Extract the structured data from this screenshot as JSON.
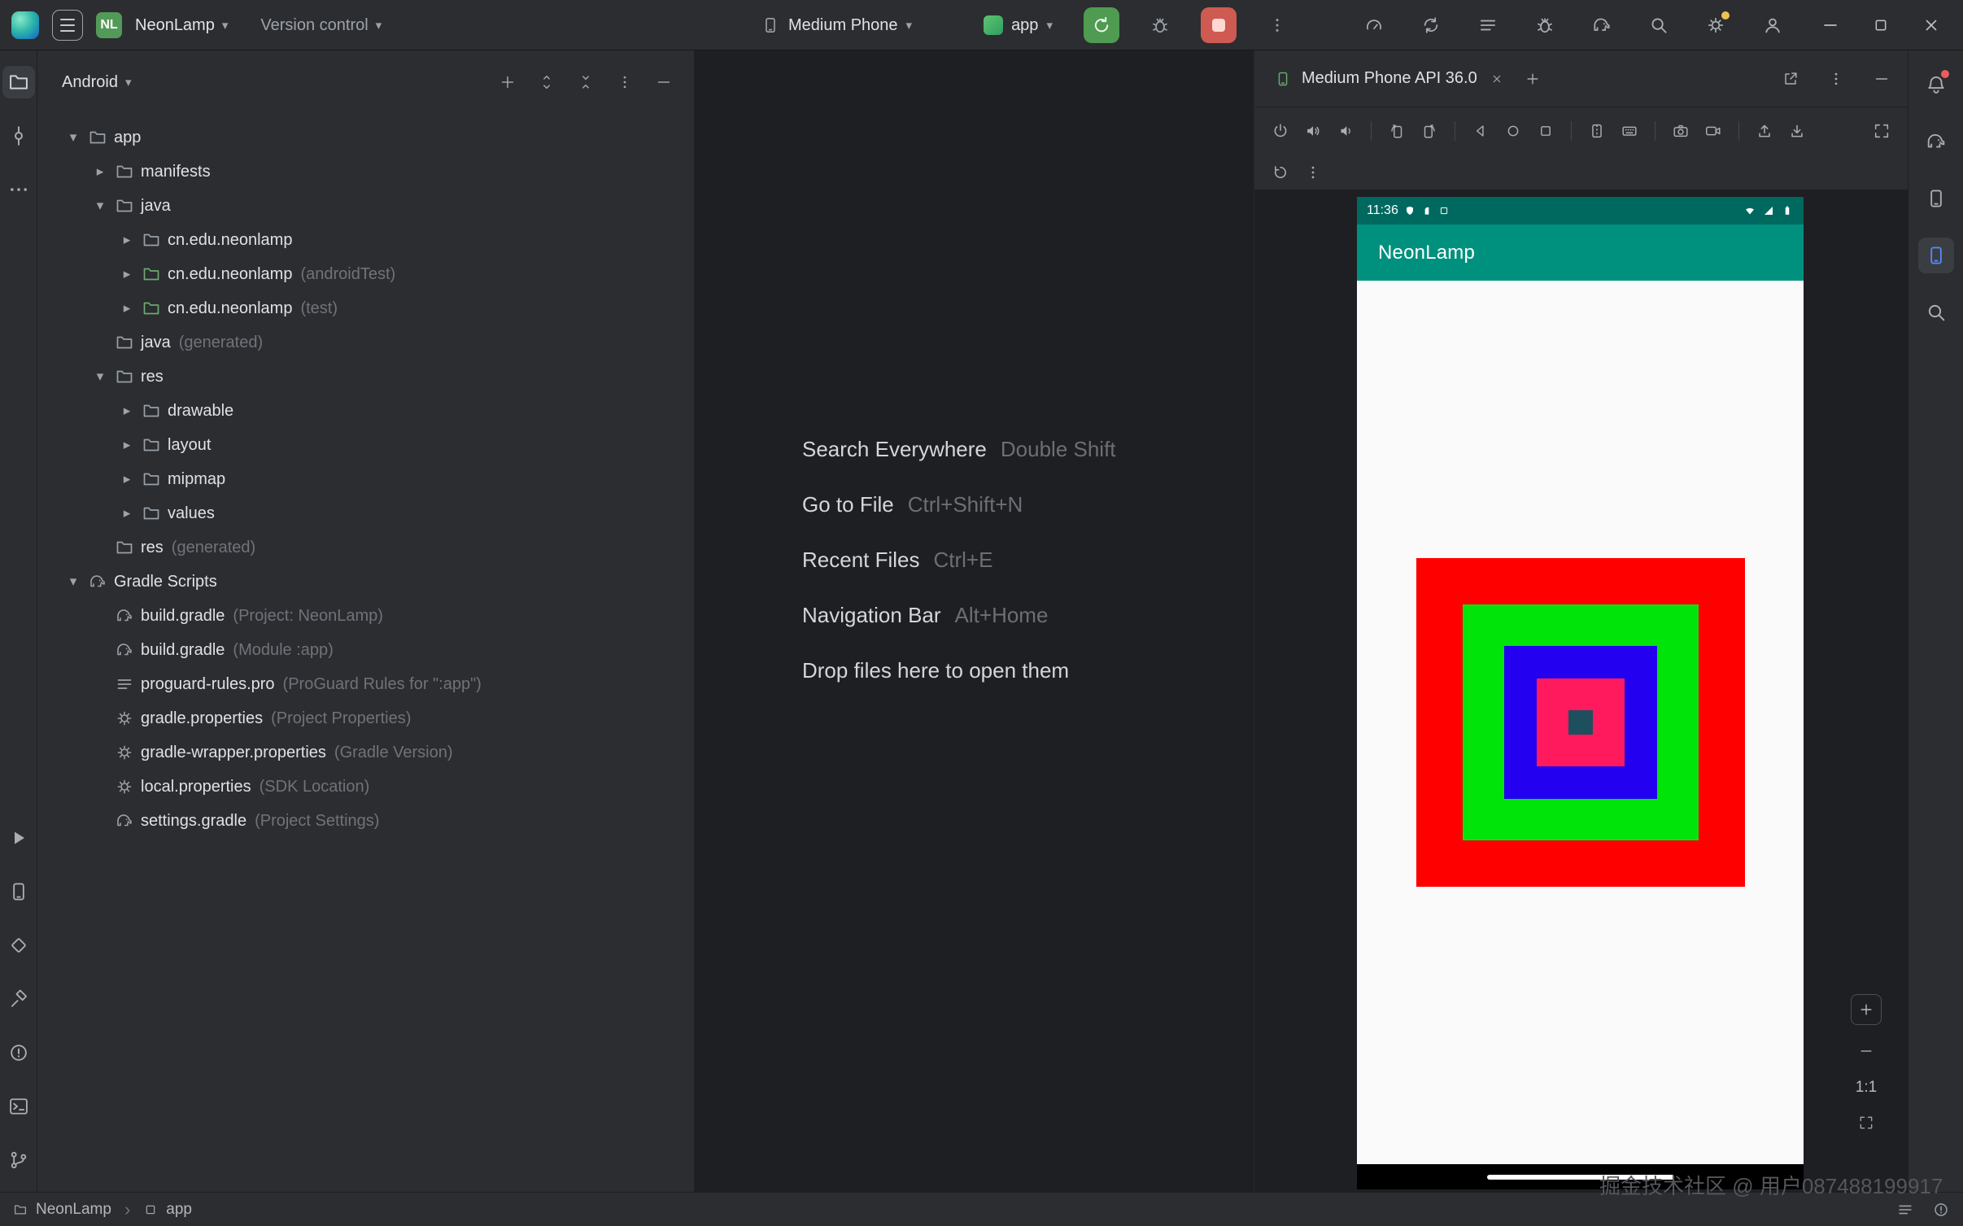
{
  "icons": {
    "chevron_down": "▾",
    "chevron_right": "▸",
    "breadcrumb_sep": "›"
  },
  "colors": {
    "run_button_bg": "#4e9b51",
    "stop_button_bg": "#ce5a52",
    "stop_button_glyph": "#ffd8d2",
    "project_badge_bg": "#539a58",
    "notification_dot": "#ec5c5c",
    "settings_update_dot": "#eec04f",
    "active_tool_accent": "#548af7",
    "tree_selection_bg": "#3f4248",
    "vcs_green_row_bg": "#2a4b38"
  },
  "titlebar": {
    "project_badge": "NL",
    "project_name": "NeonLamp",
    "version_control_label": "Version control",
    "device_selector": "Medium Phone",
    "run_config": "app"
  },
  "project_panel": {
    "view_label": "Android",
    "tree": [
      {
        "label": "app"
      },
      {
        "label": "manifests"
      },
      {
        "label": "java"
      },
      {
        "label": "cn.edu.neonlamp"
      },
      {
        "label": "cn.edu.neonlamp",
        "hint": "(androidTest)"
      },
      {
        "label": "cn.edu.neonlamp",
        "hint": "(test)"
      },
      {
        "label": "java",
        "hint": "(generated)"
      },
      {
        "label": "res"
      },
      {
        "label": "drawable"
      },
      {
        "label": "layout"
      },
      {
        "label": "mipmap"
      },
      {
        "label": "values"
      },
      {
        "label": "res",
        "hint": "(generated)"
      },
      {
        "label": "Gradle Scripts"
      },
      {
        "label": "build.gradle",
        "hint": "(Project: NeonLamp)"
      },
      {
        "label": "build.gradle",
        "hint": "(Module :app)"
      },
      {
        "label": "proguard-rules.pro",
        "hint": "(ProGuard Rules for \":app\")"
      },
      {
        "label": "gradle.properties",
        "hint": "(Project Properties)"
      },
      {
        "label": "gradle-wrapper.properties",
        "hint": "(Gradle Version)"
      },
      {
        "label": "local.properties",
        "hint": "(SDK Location)"
      },
      {
        "label": "settings.gradle",
        "hint": "(Project Settings)"
      }
    ]
  },
  "editor": {
    "hints": [
      {
        "label": "Search Everywhere",
        "keys": "Double Shift"
      },
      {
        "label": "Go to File",
        "keys": "Ctrl+Shift+N"
      },
      {
        "label": "Recent Files",
        "keys": "Ctrl+E"
      },
      {
        "label": "Navigation Bar",
        "keys": "Alt+Home"
      },
      {
        "label": "Drop files here to open them",
        "keys": ""
      }
    ]
  },
  "device_panel": {
    "tab_title": "Medium Phone API 36.0",
    "zoom_label": "1:1",
    "screen": {
      "status_time": "11:36",
      "app_title": "NeonLamp",
      "colors": {
        "status_bar": "#00695f",
        "app_bar": "#00917e",
        "screen_bg": "#fafafa",
        "nav_bar": "#000000",
        "square_red": "#ff0000",
        "square_green": "#00e40a",
        "square_blue": "#2400f0",
        "square_pink": "#ff1a5e",
        "square_center": "#1d4f5e"
      }
    }
  },
  "status_bar": {
    "project": "NeonLamp",
    "module": "app"
  },
  "watermark": "掘金技术社区 @ 用户087488199917"
}
